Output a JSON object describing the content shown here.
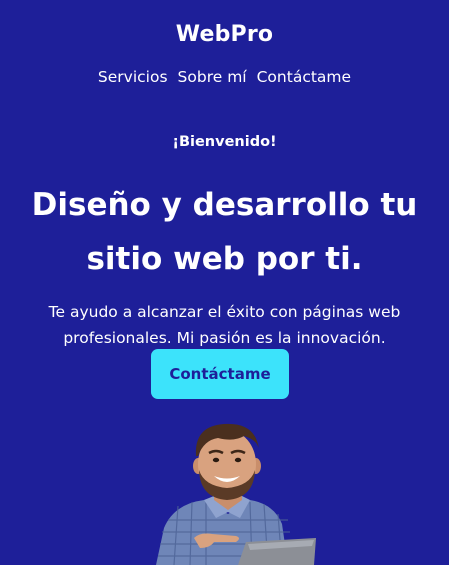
{
  "header": {
    "brand": "WebPro",
    "nav": [
      {
        "label": "Servicios"
      },
      {
        "label": "Sobre mí"
      },
      {
        "label": "Contáctame"
      }
    ]
  },
  "hero": {
    "eyebrow": "¡Bienvenido!",
    "headline": "Diseño y desarrollo tu sitio web por ti.",
    "subtitle": "Te ayudo a alcanzar el éxito con páginas web profesionales. Mi pasión es la innovación.",
    "cta_label": "Contáctame"
  },
  "colors": {
    "background": "#1e1f99",
    "accent": "#3ce3fb",
    "text": "#ffffff"
  },
  "icons": {
    "portrait": "smiling-man-with-laptop-photo"
  }
}
